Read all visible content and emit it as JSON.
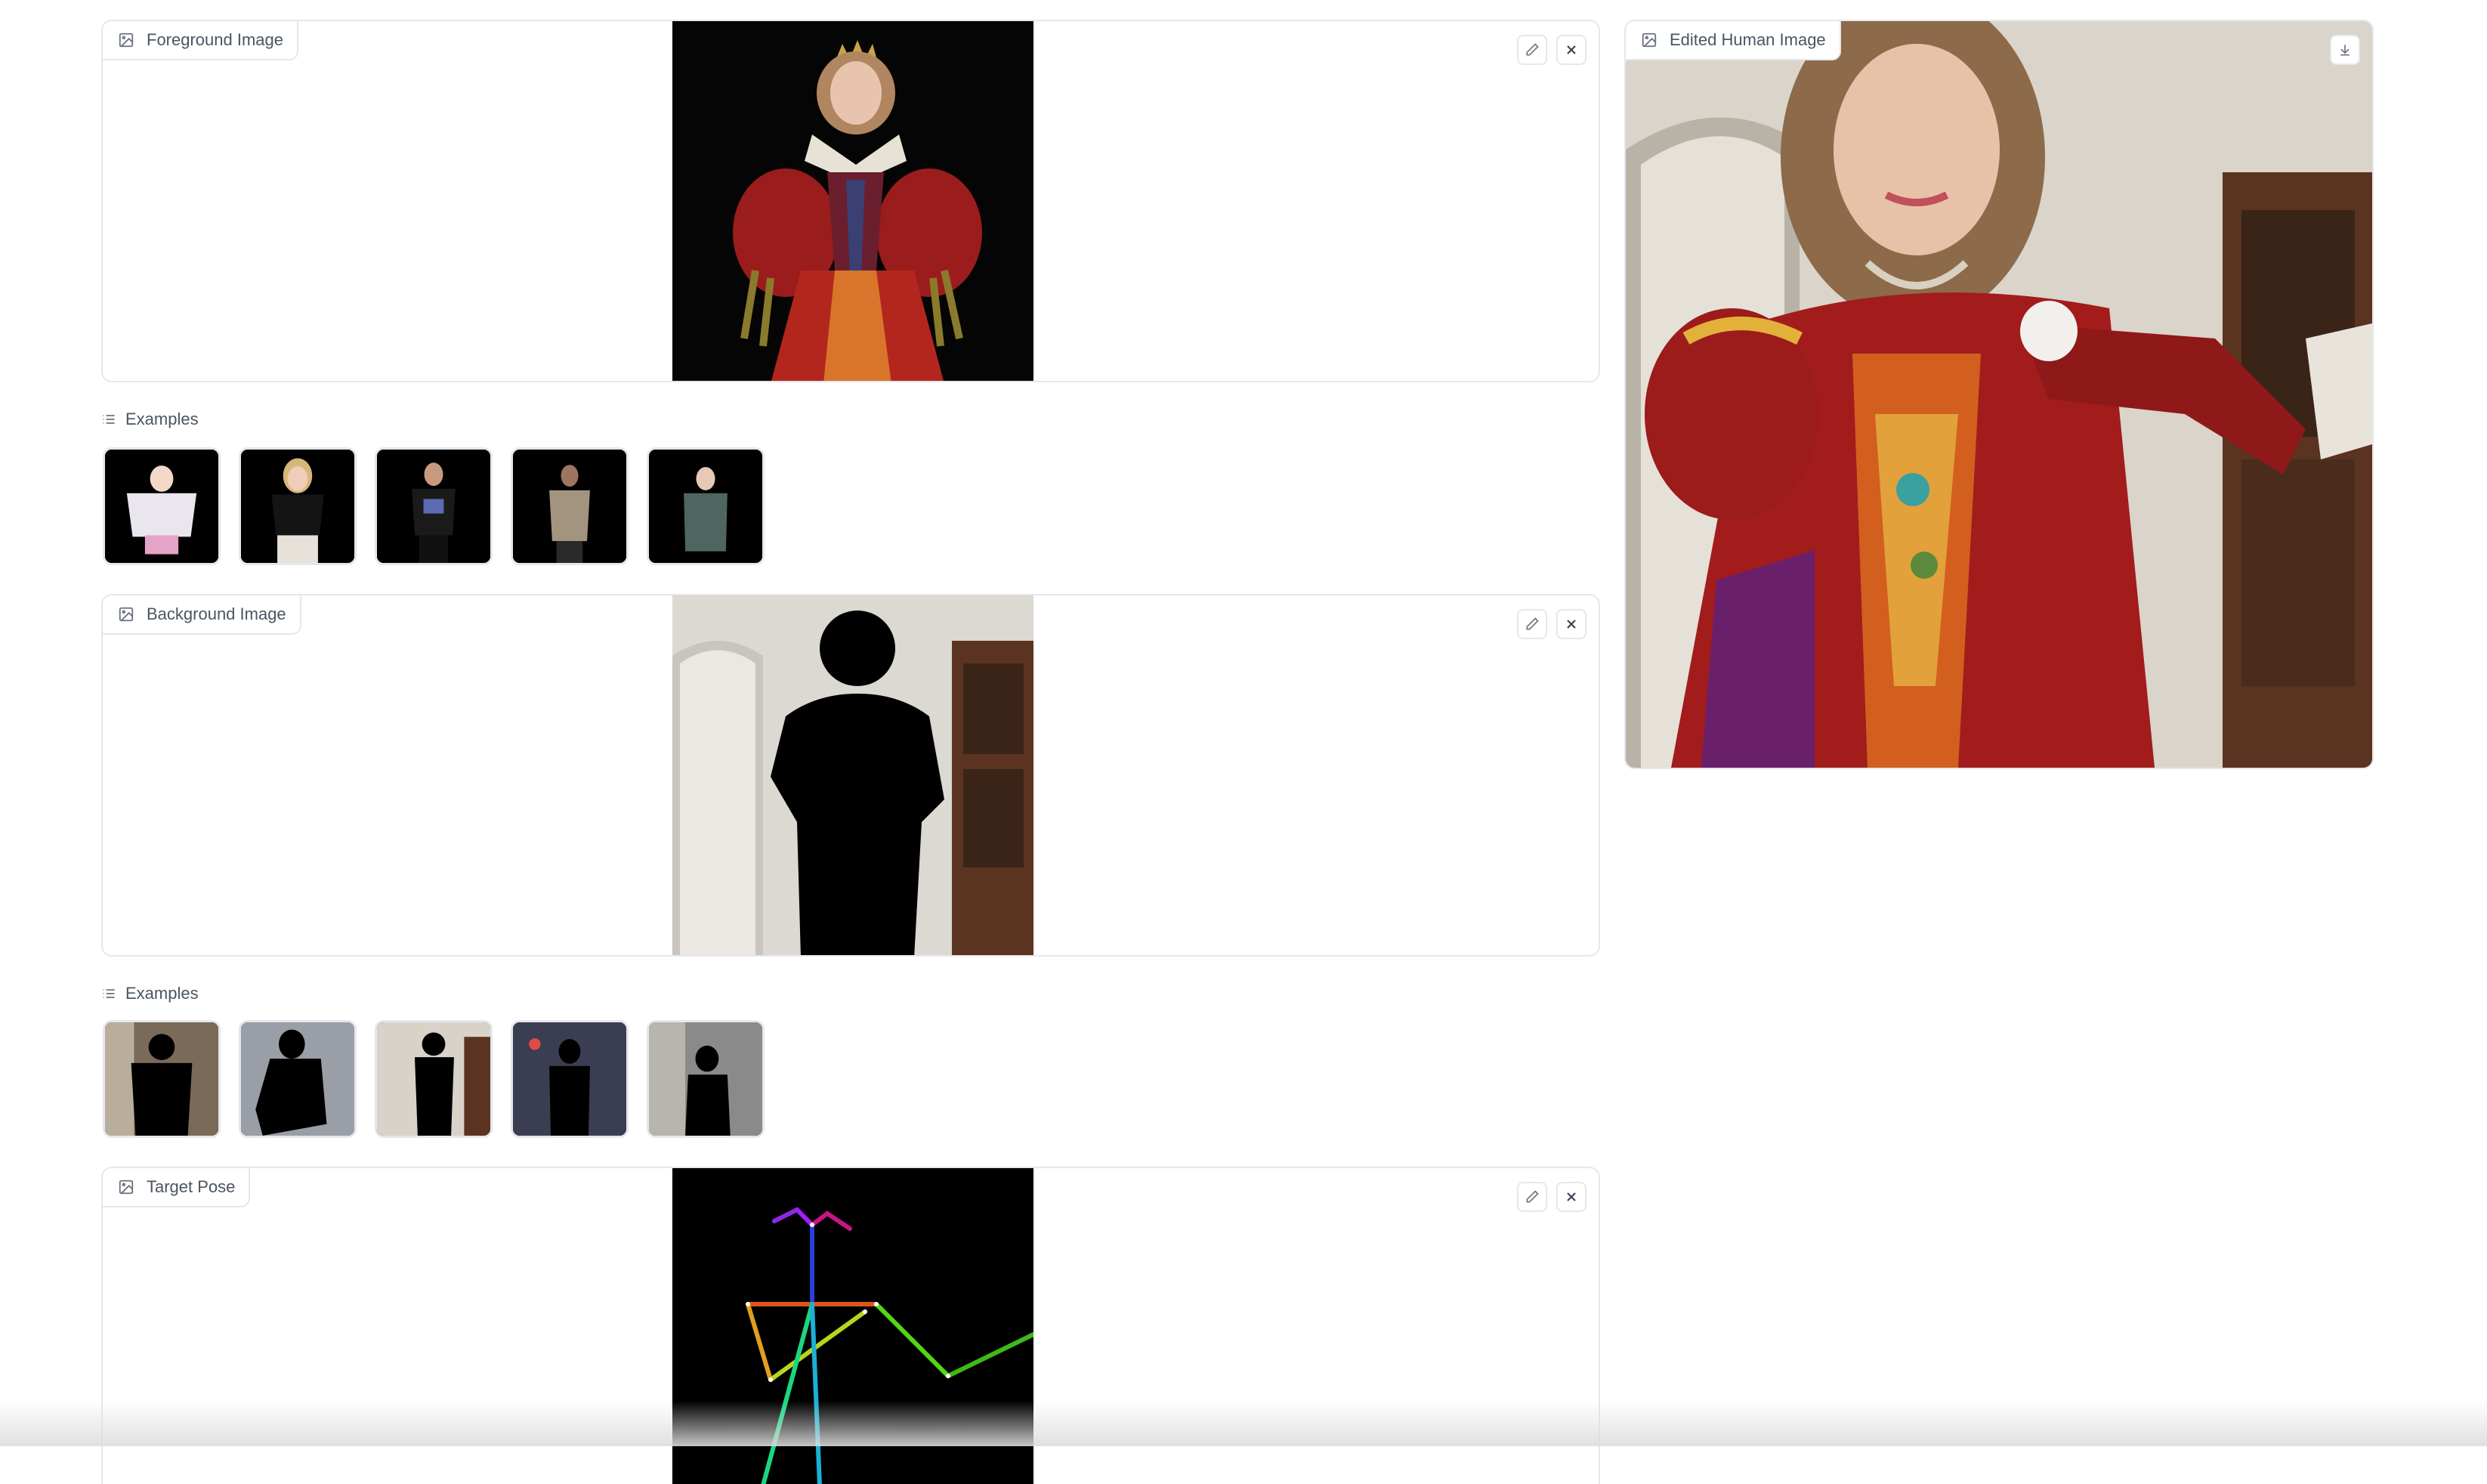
{
  "foreground": {
    "label": "Foreground Image"
  },
  "examples_1": {
    "label": "Examples"
  },
  "background": {
    "label": "Background Image"
  },
  "examples_2": {
    "label": "Examples"
  },
  "pose": {
    "label": "Target Pose"
  },
  "output": {
    "label": "Edited Human Image"
  },
  "icons": {
    "image": "image-icon",
    "edit": "pencil-icon",
    "clear": "close-icon",
    "list": "list-icon",
    "download": "download-icon"
  },
  "colors": {
    "border": "#e5e7eb",
    "label_text": "#4b5563"
  }
}
